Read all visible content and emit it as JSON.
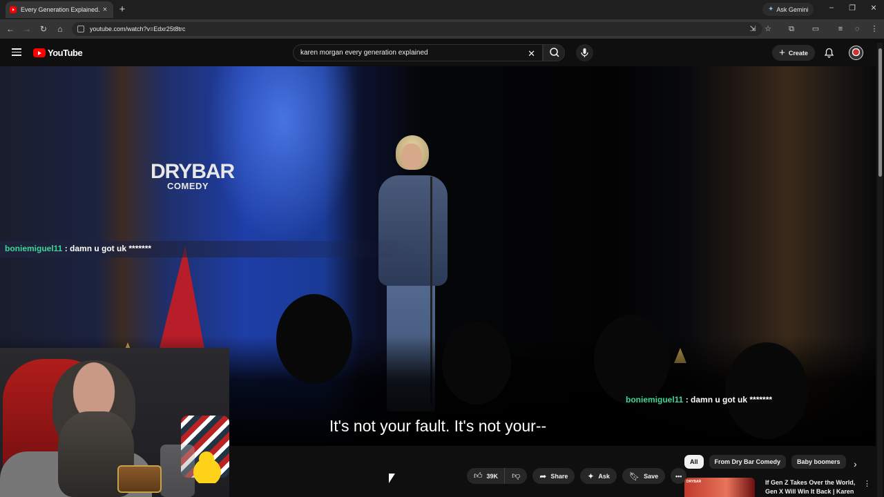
{
  "browser": {
    "tab_title": "Every Generation Explained. Ka",
    "new_tab": "+",
    "tab_close": "×",
    "ask_gemini": "Ask Gemini",
    "url": "youtube.com/watch?v=Edxr25t8trc",
    "window_controls": {
      "minimize": "–",
      "maximize": "❐",
      "close": "✕"
    }
  },
  "youtube": {
    "logo_text": "YouTube",
    "search_query": "karen morgan every generation explained",
    "clear_symbol": "✕",
    "create_label": "Create",
    "create_plus": "+"
  },
  "video": {
    "brand_name": "DRYBAR",
    "brand_sub": "COMEDY",
    "caption": "It's not your fault. It's not your--",
    "chat_top": {
      "user": "boniemiguel11",
      "message": " : damn u got uk *******"
    },
    "chat_bottom": {
      "user": "boniemiguel11",
      "message": " : damn u got uk *******"
    }
  },
  "actions": {
    "like_count": "39K",
    "share_label": "Share",
    "ask_label": "Ask",
    "save_label": "Save",
    "more_symbol": "•••"
  },
  "chips": [
    {
      "label": "All",
      "active": true
    },
    {
      "label": "From Dry Bar Comedy",
      "active": false
    },
    {
      "label": "Baby boomers",
      "active": false
    }
  ],
  "recommendation": {
    "thumb_label": "DRYBAR",
    "title": "If Gen Z Takes Over the World, Gen X Will Win It Back | Karen ..."
  },
  "colors": {
    "accent_red": "#ff0000",
    "chat_username": "#3fd69a",
    "chip_active_bg": "#f1f1f1"
  },
  "icons": {
    "back": "back-arrow-icon",
    "forward": "forward-arrow-icon",
    "reload": "reload-icon",
    "home": "home-icon",
    "search": "search-icon",
    "mic": "microphone-icon",
    "bell": "bell-icon",
    "like": "thumbs-up-icon",
    "dislike": "thumbs-down-icon",
    "share": "share-arrow-icon",
    "ask": "sparkle-icon",
    "save": "bookmark-icon"
  }
}
